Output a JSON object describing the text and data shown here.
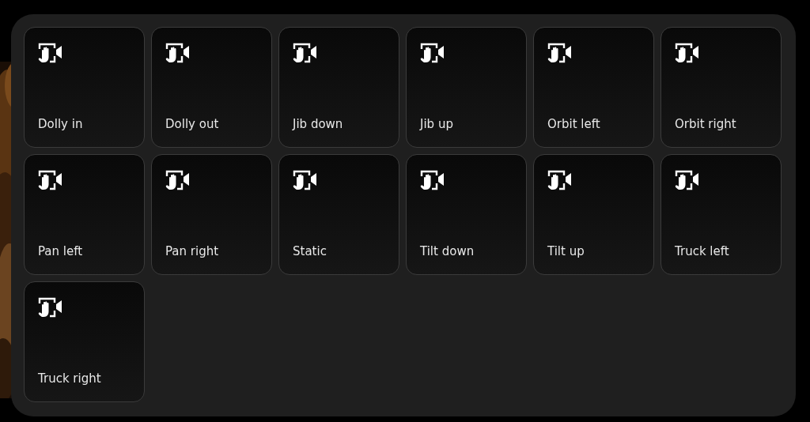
{
  "presets": [
    {
      "label": "Dolly in"
    },
    {
      "label": "Dolly out"
    },
    {
      "label": "Jib down"
    },
    {
      "label": "Jib up"
    },
    {
      "label": "Orbit left"
    },
    {
      "label": "Orbit right"
    },
    {
      "label": "Pan left"
    },
    {
      "label": "Pan right"
    },
    {
      "label": "Static"
    },
    {
      "label": "Tilt down"
    },
    {
      "label": "Tilt up"
    },
    {
      "label": "Truck left"
    },
    {
      "label": "Truck right"
    }
  ]
}
